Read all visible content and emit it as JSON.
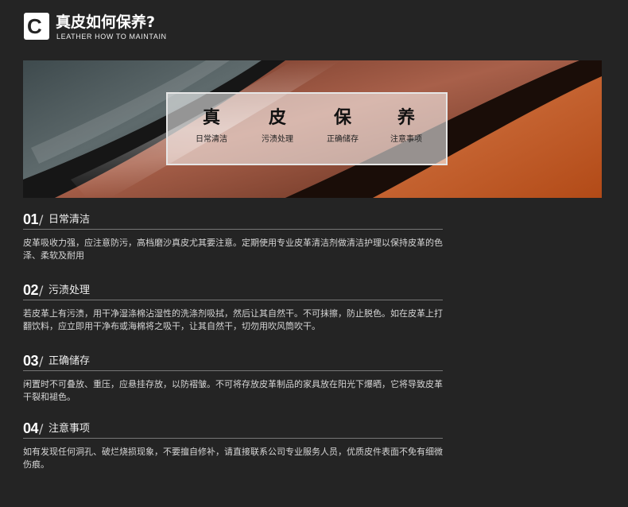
{
  "header": {
    "logo_letter": "C",
    "title_cn": "真皮如何保养?",
    "title_en": "LEATHER HOW TO MAINTAIN"
  },
  "banner": {
    "pillars": [
      {
        "big": "真",
        "small": "日常清洁"
      },
      {
        "big": "皮",
        "small": "污渍处理"
      },
      {
        "big": "保",
        "small": "正确储存"
      },
      {
        "big": "养",
        "small": "注意事项"
      }
    ]
  },
  "sections": [
    {
      "num": "01",
      "slash": "/",
      "title": "日常清洁",
      "body": "皮革吸收力强，应注意防污，高档磨沙真皮尤其要注意。定期使用专业皮革清洁剂做清洁护理以保持皮革的色泽、柔软及耐用"
    },
    {
      "num": "02",
      "slash": "/",
      "title": "污渍处理",
      "body": "若皮革上有污渍，用干净湿涤棉沾湿性的洗涤剂吸拭，然后让其自然干。不可抹擦，防止脱色。如在皮革上打翻饮料，应立即用干净布或海棉将之吸干，让其自然干，切勿用吹风筒吹干。"
    },
    {
      "num": "03",
      "slash": "/",
      "title": "正确储存",
      "body": "闲置时不可叠放、重压，应悬挂存放，以防褶皱。不可将存放皮革制品的家具放在阳光下爆晒，它将导致皮革干裂和褪色。"
    },
    {
      "num": "04",
      "slash": "/",
      "title": "注意事项",
      "body": "如有发现任何洞孔、破烂烧损现象，不要擅自修补，请直接联系公司专业服务人员，优质皮件表面不免有细微伤痕。"
    }
  ]
}
